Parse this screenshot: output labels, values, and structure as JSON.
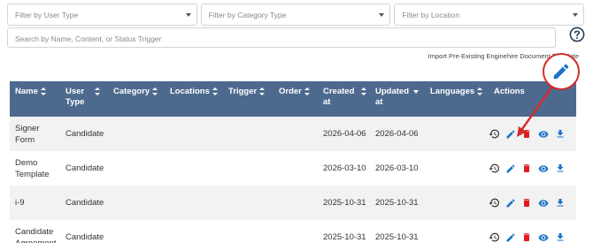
{
  "filters": {
    "user_type": "Filter by User Type",
    "category_type": "Filter by Category Type",
    "location": "Filter by Location"
  },
  "search": {
    "placeholder": "Search by Name, Content, or Status Trigger"
  },
  "import_link": "Import Pre-Existing Enginehire Document Template",
  "columns": [
    {
      "label": "Name",
      "sort": "both"
    },
    {
      "label": "User Type",
      "sort": "both"
    },
    {
      "label": "Category",
      "sort": "both"
    },
    {
      "label": "Locations",
      "sort": "both"
    },
    {
      "label": "Trigger",
      "sort": "both"
    },
    {
      "label": "Order",
      "sort": "both"
    },
    {
      "label": "Created at",
      "sort": "both"
    },
    {
      "label": "Updated at",
      "sort": "desc"
    },
    {
      "label": "Languages",
      "sort": "both"
    },
    {
      "label": "Actions",
      "sort": "none"
    }
  ],
  "rows": [
    {
      "name": "Signer Form",
      "user_type": "Candidate",
      "category": "",
      "locations": "",
      "trigger": "",
      "order": "",
      "created": "2026-04-06",
      "updated": "2026-04-06",
      "languages": ""
    },
    {
      "name": "Demo Template",
      "user_type": "Candidate",
      "category": "",
      "locations": "",
      "trigger": "",
      "order": "",
      "created": "2026-03-10",
      "updated": "2026-03-10",
      "languages": ""
    },
    {
      "name": "i-9",
      "user_type": "Candidate",
      "category": "",
      "locations": "",
      "trigger": "",
      "order": "",
      "created": "2025-10-31",
      "updated": "2025-10-31",
      "languages": ""
    },
    {
      "name": "Candidate Agreement",
      "user_type": "Candidate",
      "category": "",
      "locations": "",
      "trigger": "",
      "order": "",
      "created": "2025-10-31",
      "updated": "2025-10-31",
      "languages": ""
    }
  ],
  "action_icons": [
    "history-icon",
    "edit-pencil-icon",
    "delete-trash-icon",
    "view-eye-icon",
    "download-icon"
  ],
  "colors": {
    "header_bg": "#4d6a8e",
    "edit_blue": "#1a73c9",
    "delete_red": "#e21b23",
    "callout_red": "#d62b2b"
  }
}
